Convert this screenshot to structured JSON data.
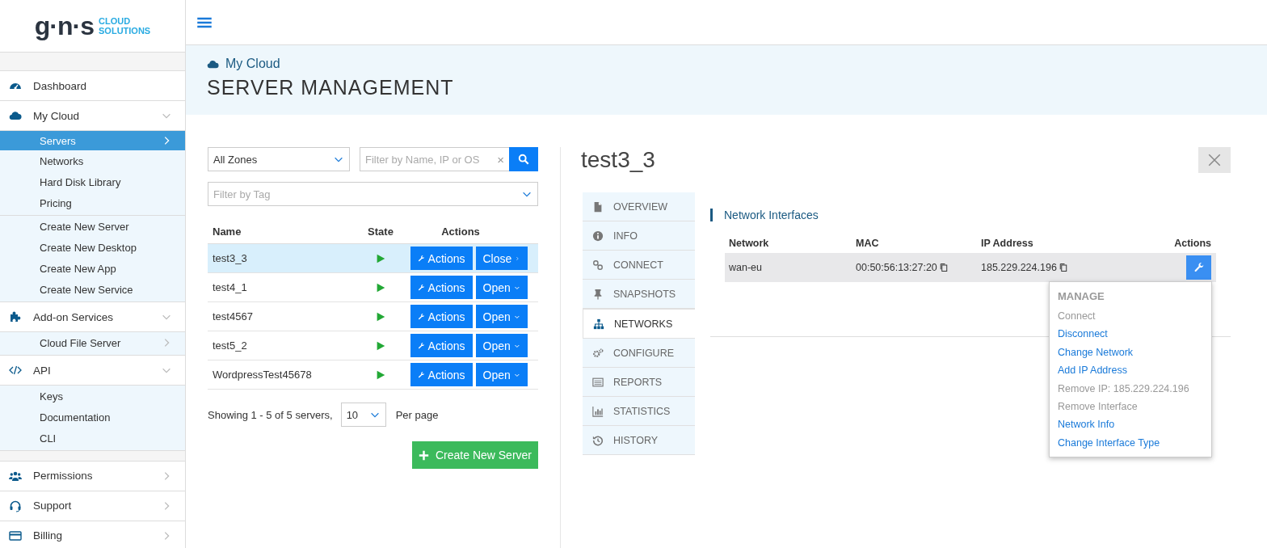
{
  "logo": {
    "mark": "g·n·s",
    "line1": "CLOUD",
    "line2": "SOLUTIONS"
  },
  "sidebar": {
    "main": [
      {
        "label": "Dashboard"
      },
      {
        "label": "My Cloud",
        "expanded": true,
        "sections": [
          [
            {
              "label": "Servers",
              "selected": true,
              "expanded": false
            },
            {
              "label": "Networks",
              "selected": false
            },
            {
              "label": "Hard Disk Library",
              "selected": false
            },
            {
              "label": "Pricing",
              "selected": false
            }
          ],
          [
            {
              "label": "Create New Server",
              "selected": false
            },
            {
              "label": "Create New Desktop",
              "selected": false
            },
            {
              "label": "Create New App",
              "selected": false
            },
            {
              "label": "Create New Service",
              "selected": false
            }
          ]
        ]
      },
      {
        "label": "Add-on Services",
        "expanded": true,
        "sections": [
          [
            {
              "label": "Cloud File Server",
              "selected": false,
              "expanded": false
            }
          ]
        ]
      },
      {
        "label": "API",
        "expanded": true,
        "sections": [
          [
            {
              "label": "Keys",
              "selected": false
            },
            {
              "label": "Documentation",
              "selected": false
            },
            {
              "label": "CLI",
              "selected": false
            }
          ]
        ]
      }
    ],
    "footer": [
      {
        "label": "Permissions",
        "expanded": false
      },
      {
        "label": "Support",
        "expanded": false
      },
      {
        "label": "Billing",
        "expanded": false
      }
    ]
  },
  "header": {
    "breadcrumb": "My Cloud",
    "title": "SERVER MANAGEMENT"
  },
  "filters": {
    "zone": "All Zones",
    "search_placeholder": "Filter by Name, IP or OS",
    "clear": "×",
    "tag_placeholder": "Filter by Tag"
  },
  "servers": {
    "columns": [
      "Name",
      "State",
      "Actions"
    ],
    "rows": [
      {
        "name": "test3_3",
        "running": true,
        "selected": true,
        "actions": "Actions",
        "toggle": "Close"
      },
      {
        "name": "test4_1",
        "running": true,
        "selected": false,
        "actions": "Actions",
        "toggle": "Open"
      },
      {
        "name": "test4567",
        "running": true,
        "selected": false,
        "actions": "Actions",
        "toggle": "Open"
      },
      {
        "name": "test5_2",
        "running": true,
        "selected": false,
        "actions": "Actions",
        "toggle": "Open"
      },
      {
        "name": "WordpressTest45678",
        "running": true,
        "selected": false,
        "actions": "Actions",
        "toggle": "Open"
      }
    ],
    "summary": "Showing 1 - 5 of 5 servers,",
    "per_page": "10",
    "per_page_label": "Per page",
    "create": "Create New Server"
  },
  "detail": {
    "title": "test3_3",
    "tabs": [
      {
        "label": "OVERVIEW",
        "selected": false
      },
      {
        "label": "INFO",
        "selected": false
      },
      {
        "label": "CONNECT",
        "selected": false
      },
      {
        "label": "SNAPSHOTS",
        "selected": false
      },
      {
        "label": "NETWORKS",
        "selected": true
      },
      {
        "label": "CONFIGURE",
        "selected": false
      },
      {
        "label": "REPORTS",
        "selected": false
      },
      {
        "label": "STATISTICS",
        "selected": false
      },
      {
        "label": "HISTORY",
        "selected": false
      }
    ],
    "section_title": "Network Interfaces",
    "columns": [
      "Network",
      "MAC",
      "IP Address",
      "Actions"
    ],
    "interfaces": [
      {
        "network": "wan-eu",
        "mac": "00:50:56:13:27:20",
        "ip": "185.229.224.196"
      }
    ],
    "menu": {
      "header": "MANAGE",
      "items": [
        {
          "label": "Connect",
          "disabled": true
        },
        {
          "label": "Disconnect",
          "disabled": false
        },
        {
          "label": "Change Network",
          "disabled": false
        },
        {
          "label": "Add IP Address",
          "disabled": false
        },
        {
          "label": "Remove IP: 185.229.224.196",
          "disabled": true
        },
        {
          "label": "Remove Interface",
          "disabled": true
        },
        {
          "label": "Network Info",
          "disabled": false
        },
        {
          "label": "Change Interface Type",
          "disabled": false
        }
      ]
    }
  }
}
